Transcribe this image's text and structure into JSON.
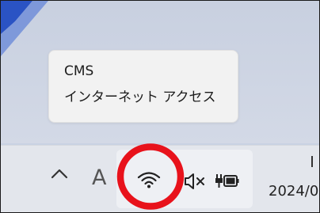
{
  "tooltip": {
    "title": "CMS",
    "subtitle": "インターネット アクセス"
  },
  "taskbar": {
    "ime_indicator": "A",
    "date_partial": "2024/0",
    "icons": [
      "chevron-up-icon",
      "wifi-icon",
      "speaker-muted-icon",
      "battery-charging-icon"
    ]
  },
  "annotation": {
    "circle_color": "#e8121b"
  },
  "colors": {
    "wallpaper_blue": "#1f4ed8",
    "taskbar_bg": "#e3e6ec",
    "tooltip_bg": "#f2f2f2"
  }
}
